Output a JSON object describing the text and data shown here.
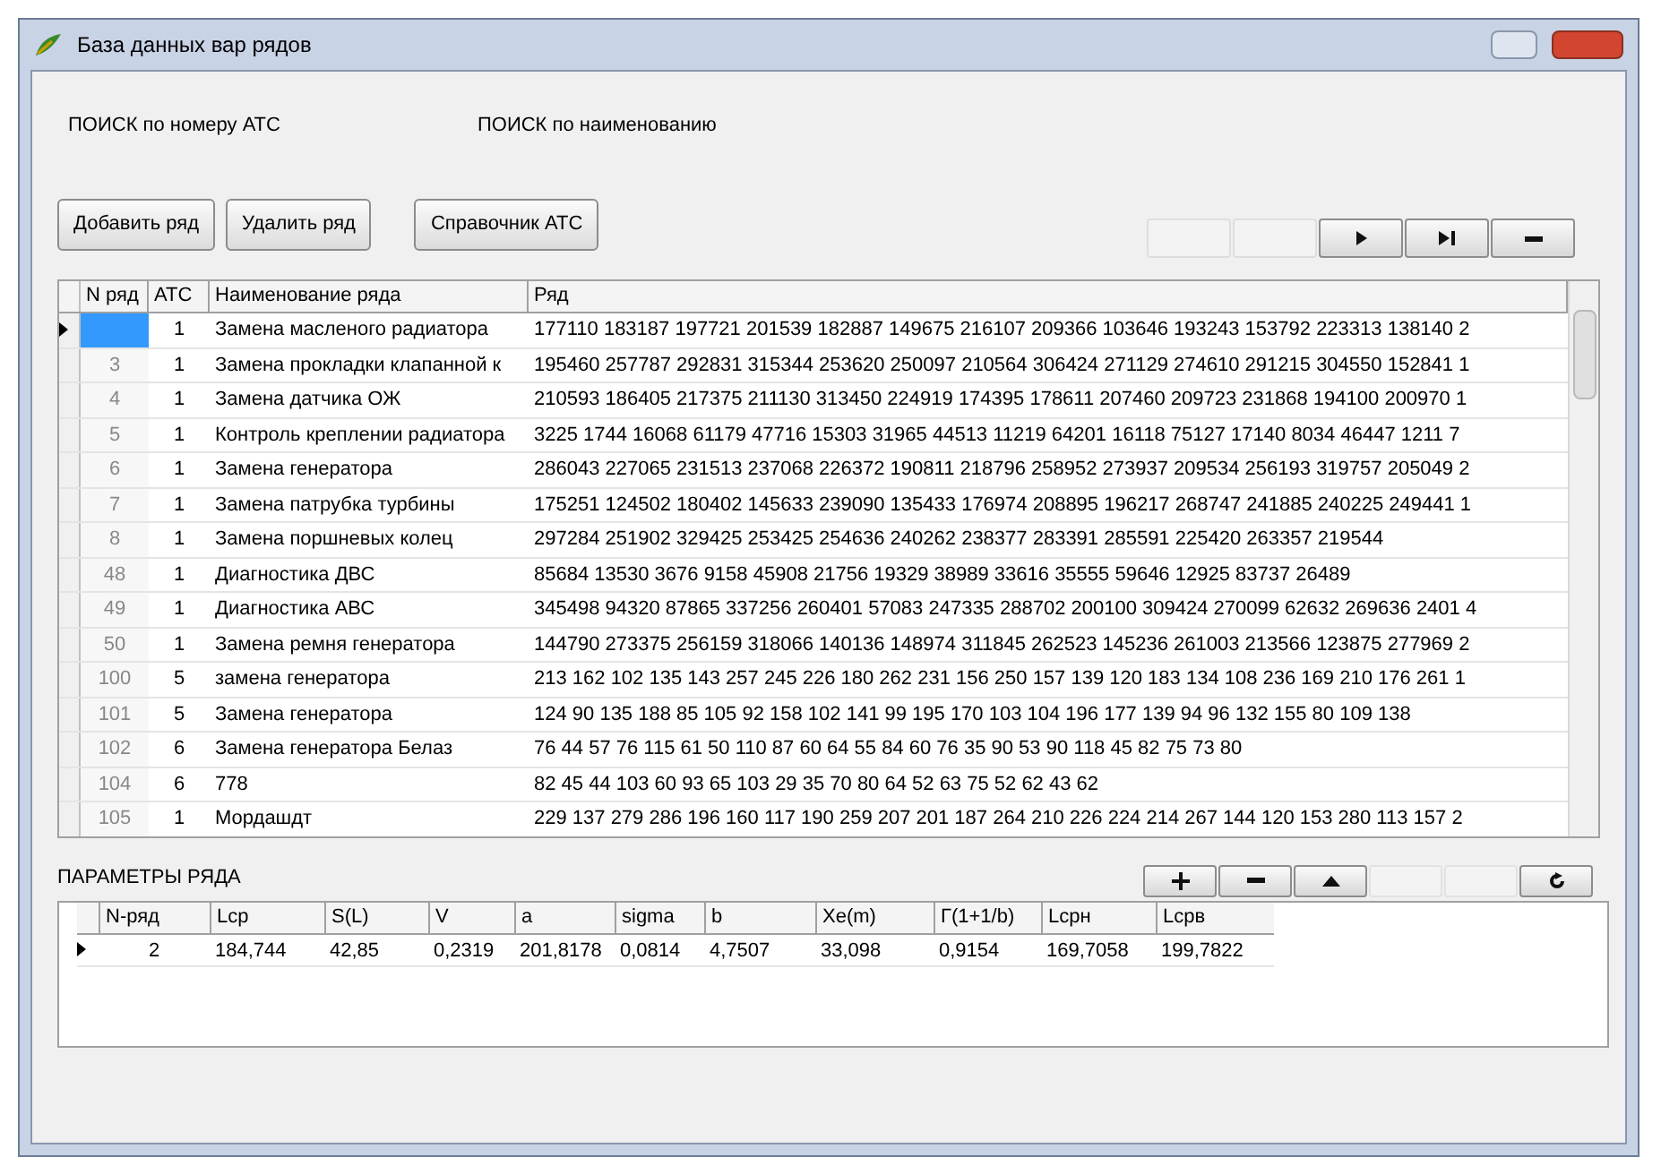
{
  "window": {
    "title": "База данных вар рядов"
  },
  "search": [
    {
      "label": "ПОИСК по номеру АТС"
    },
    {
      "label": "ПОИСК по наименованию"
    }
  ],
  "buttons": [
    {
      "label": "Добавить ряд"
    },
    {
      "label": "Удалить ряд"
    },
    {
      "label": "Справочник АТС"
    }
  ],
  "navigator": [
    {
      "disabled": true
    },
    {
      "disabled": true
    },
    {
      "disabled": false
    },
    {
      "disabled": false
    },
    {
      "disabled": false
    }
  ],
  "table": {
    "columns": [
      "N ряд",
      "АТС",
      "Наименование ряда",
      "Ряд"
    ],
    "rows": [
      {
        "selected": true,
        "cells": [
          "",
          "1",
          "Замена масленого радиатора",
          "177110 183187 197721 201539 182887 149675 216107 209366 103646 193243 153792 223313 138140 2"
        ]
      },
      {
        "selected": false,
        "cells": [
          "3",
          "1",
          "Замена прокладки клапанной к",
          "195460 257787 292831 315344 253620 250097 210564 306424 271129 274610 291215 304550 152841 1"
        ]
      },
      {
        "selected": false,
        "cells": [
          "4",
          "1",
          "Замена датчика ОЖ",
          "210593 186405 217375 211130 313450 224919 174395 178611 207460 209723 231868 194100 200970 1"
        ]
      },
      {
        "selected": false,
        "cells": [
          "5",
          "1",
          "Контроль креплении радиатора",
          "3225 1744 16068 61179 47716 15303 31965 44513 11219 64201 16118 75127 17140 8034 46447 1211 7"
        ]
      },
      {
        "selected": false,
        "cells": [
          "6",
          "1",
          "Замена генератора",
          "286043 227065 231513 237068 226372 190811 218796 258952 273937 209534 256193 319757 205049 2"
        ]
      },
      {
        "selected": false,
        "cells": [
          "7",
          "1",
          "Замена патрубка турбины",
          "175251 124502 180402 145633 239090 135433 176974 208895 196217 268747 241885 240225 249441 1"
        ]
      },
      {
        "selected": false,
        "cells": [
          "8",
          "1",
          "Замена поршневых колец",
          "297284 251902 329425 253425 254636 240262 238377 283391 285591 225420 263357 219544"
        ]
      },
      {
        "selected": false,
        "cells": [
          "48",
          "1",
          "Диагностика ДВС",
          "85684 13530 3676 9158 45908 21756 19329 38989 33616 35555 59646 12925 83737 26489"
        ]
      },
      {
        "selected": false,
        "cells": [
          "49",
          "1",
          "Диагностика АВС",
          "345498 94320 87865 337256 260401 57083 247335 288702 200100 309424 270099 62632 269636 2401 4"
        ]
      },
      {
        "selected": false,
        "cells": [
          "50",
          "1",
          "Замена ремня генератора",
          "144790 273375 256159 318066 140136 148974 311845 262523 145236 261003 213566 123875 277969 2"
        ]
      },
      {
        "selected": false,
        "cells": [
          "100",
          "5",
          "замена генератора",
          "213 162 102 135 143 257 245 226 180 262 231 156 250 157 139 120 183 134 108 236 169 210 176 261 1"
        ]
      },
      {
        "selected": false,
        "cells": [
          "101",
          "5",
          "Замена генератора",
          "124 90 135 188 85 105 92 158 102 141 99 195 170 103 104 196 177 139 94 96 132 155 80 109 138"
        ]
      },
      {
        "selected": false,
        "cells": [
          "102",
          "6",
          "Замена генератора Белаз",
          "76 44 57 76 115 61 50 110 87 60 64 55 84 60 76 35 90 53 90 118 45 82 75 73 80"
        ]
      },
      {
        "selected": false,
        "cells": [
          "104",
          "6",
          "778",
          "82 45 44 103 60 93 65 103 29 35 70 80 64 52 63 75 52 62 43 62"
        ]
      },
      {
        "selected": false,
        "cells": [
          "105",
          "1",
          "Мордашдт",
          "229 137 279 286 196 160 117 190 259 207 201 187 264 210 226 224 214 267 144 120 153 280 113 157 2"
        ]
      }
    ]
  },
  "params": {
    "title": "ПАРАМЕТРЫ РЯДА",
    "toolbar": [
      {
        "disabled": false
      },
      {
        "disabled": false
      },
      {
        "disabled": false
      },
      {
        "disabled": true
      },
      {
        "disabled": true
      },
      {
        "disabled": false
      }
    ],
    "columns": [
      "N-ряд",
      "Lcp",
      "S(L)",
      "V",
      "a",
      "sigma",
      "b",
      "Xe(m)",
      "Г(1+1/b)",
      "Lcpн",
      "Lcpв"
    ],
    "rows": [
      {
        "selected": true,
        "cells": [
          "2",
          "184,744",
          "42,85",
          "0,2319",
          "201,8178",
          "0,0814",
          "4,7507",
          "33,098",
          "0,9154",
          "169,7058",
          "199,7822"
        ]
      }
    ]
  }
}
